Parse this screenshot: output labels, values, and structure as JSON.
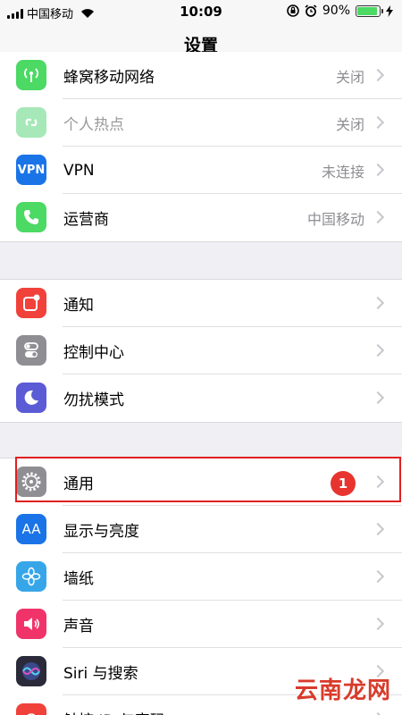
{
  "status_bar": {
    "carrier": "中国移动",
    "time": "10:09",
    "battery": "90%",
    "battery_level": 0.9
  },
  "nav": {
    "title": "设置"
  },
  "groups": [
    {
      "rows": [
        {
          "label": "蜂窝移动网络",
          "value": "关闭",
          "icon": "cellular-icon",
          "color": "#4cd964"
        },
        {
          "label": "个人热点",
          "value": "关闭",
          "icon": "hotspot-icon",
          "color": "#a7e8b8",
          "dim": true
        },
        {
          "label": "VPN",
          "value": "未连接",
          "icon": "vpn-icon",
          "icon_text": "VPN",
          "color": "#1a74e8"
        },
        {
          "label": "运营商",
          "value": "中国移动",
          "icon": "phone-icon",
          "color": "#4cd964"
        }
      ]
    },
    {
      "rows": [
        {
          "label": "通知",
          "icon": "notification-icon",
          "color": "#f0423a"
        },
        {
          "label": "控制中心",
          "icon": "control-center-icon",
          "color": "#8e8e93"
        },
        {
          "label": "勿扰模式",
          "icon": "moon-icon",
          "color": "#5c5bd6"
        }
      ]
    },
    {
      "rows": [
        {
          "label": "通用",
          "icon": "gear-icon",
          "color": "#8e8e93"
        },
        {
          "label": "显示与亮度",
          "icon": "display-icon",
          "icon_text": "AA",
          "color": "#1a74e8"
        },
        {
          "label": "墙纸",
          "icon": "wallpaper-icon",
          "color": "#37a6e8"
        },
        {
          "label": "声音",
          "icon": "sound-icon",
          "color": "#f0346a"
        },
        {
          "label": "Siri 与搜索",
          "icon": "siri-icon",
          "color": "#2a2a3a"
        },
        {
          "label": "触控 ID 与密码",
          "icon": "fingerprint-icon",
          "color": "#f0423a"
        }
      ]
    }
  ],
  "annotation": {
    "badge": "1"
  },
  "watermark": {
    "text": "云南龙网"
  }
}
